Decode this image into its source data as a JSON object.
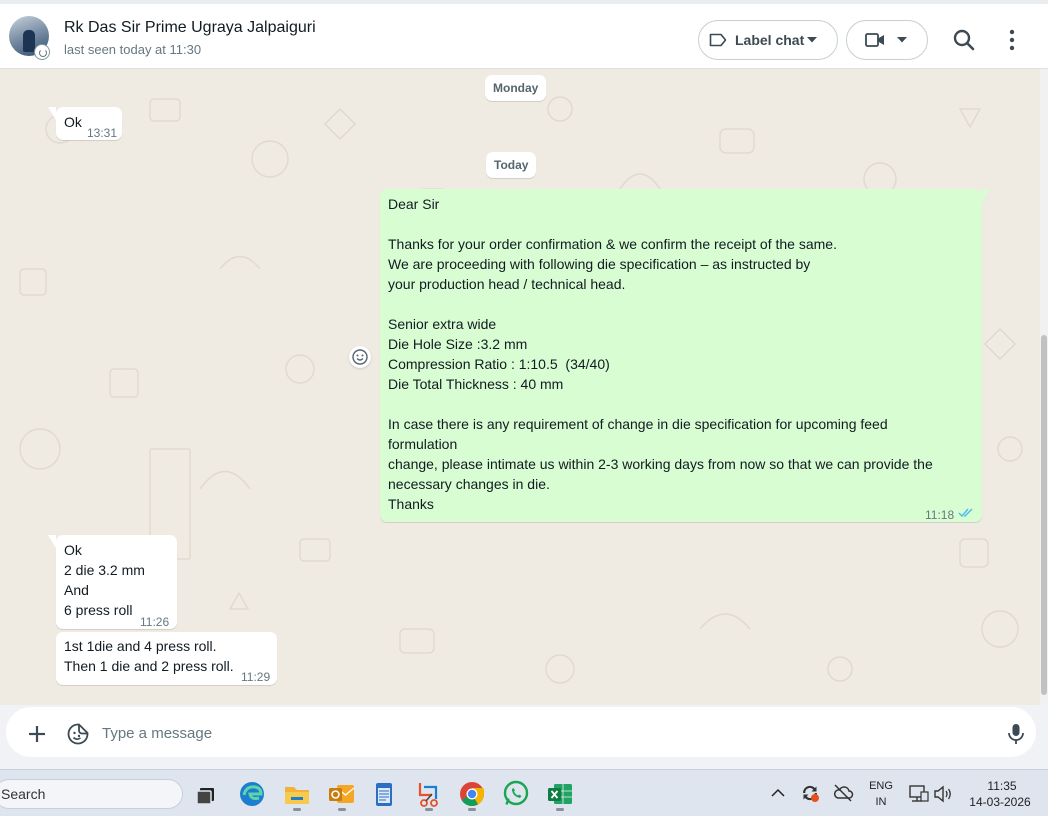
{
  "header": {
    "contact_name": "Rk Das Sir Prime Ugraya Jalpaiguri",
    "last_seen": "last seen today at 11:30",
    "label_chat": "Label chat"
  },
  "chat": {
    "date_chips": [
      "Monday",
      "Today"
    ],
    "messages": [
      {
        "direction": "in",
        "lines": [
          "Ok"
        ],
        "time": "13:31"
      },
      {
        "direction": "out",
        "lines": [
          "Dear Sir",
          "",
          "Thanks for your order confirmation & we confirm the receipt of the same.",
          "We are proceeding with following die specification – as instructed by",
          "your production head / technical head.",
          "",
          "Senior extra wide",
          "Die Hole Size :3.2 mm",
          "Compression Ratio : 1:10.5  (34/40)",
          "Die Total Thickness : 40 mm",
          "",
          "In case there is any requirement of change in die specification for upcoming feed",
          "formulation",
          "change, please intimate us within 2-3 working days from now so that we can provide the",
          "necessary changes in die.",
          "Thanks"
        ],
        "time": "11:18",
        "status": "read"
      },
      {
        "direction": "in",
        "lines": [
          "Ok",
          "2 die 3.2 mm",
          "And",
          "6 press roll"
        ],
        "time": "11:26"
      },
      {
        "direction": "in",
        "lines": [
          "1st 1die and 4 press roll.",
          "Then 1 die and 2 press roll."
        ],
        "time": "11:29"
      }
    ]
  },
  "composer": {
    "placeholder": "Type a message"
  },
  "taskbar": {
    "search_label": "Search",
    "language_top": "ENG",
    "language_bottom": "IN",
    "clock_time": "11:35",
    "clock_date": "14-03-2026",
    "pinned_apps": [
      "task-view-icon",
      "edge-icon",
      "file-explorer-icon",
      "outlook-icon",
      "notepad-icon",
      "snipping-tool-icon",
      "chrome-icon",
      "whatsapp-icon",
      "excel-icon"
    ]
  },
  "colors": {
    "outgoing_bubble": "#d9fdd3",
    "incoming_bubble": "#ffffff",
    "chat_background": "#efeae2",
    "read_ticks": "#53bdeb"
  }
}
